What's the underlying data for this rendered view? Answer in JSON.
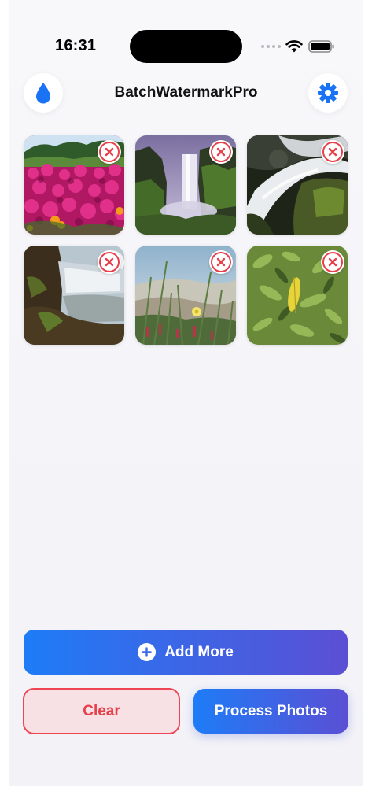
{
  "status_bar": {
    "time": "16:31"
  },
  "header": {
    "title": "BatchWatermarkPro",
    "left_icon": "water-drop-icon",
    "right_icon": "gear-icon"
  },
  "photos": [
    {
      "subject": "pink flower field",
      "remove_icon": "close-icon"
    },
    {
      "subject": "waterfall between cliffs",
      "remove_icon": "close-icon"
    },
    {
      "subject": "cascading stream over rocks",
      "remove_icon": "close-icon"
    },
    {
      "subject": "waterfall with mossy rocks",
      "remove_icon": "close-icon"
    },
    {
      "subject": "coastal grass with yellow flower",
      "remove_icon": "close-icon"
    },
    {
      "subject": "green leaves with yellow leaf",
      "remove_icon": "close-icon"
    }
  ],
  "actions": {
    "add_more_label": "Add More",
    "clear_label": "Clear",
    "process_label": "Process Photos"
  },
  "colors": {
    "accent_blue": "#1e7cf7",
    "accent_purple": "#5b4fd4",
    "destructive_red": "#e8404a",
    "clear_background": "#f8e1e5"
  }
}
